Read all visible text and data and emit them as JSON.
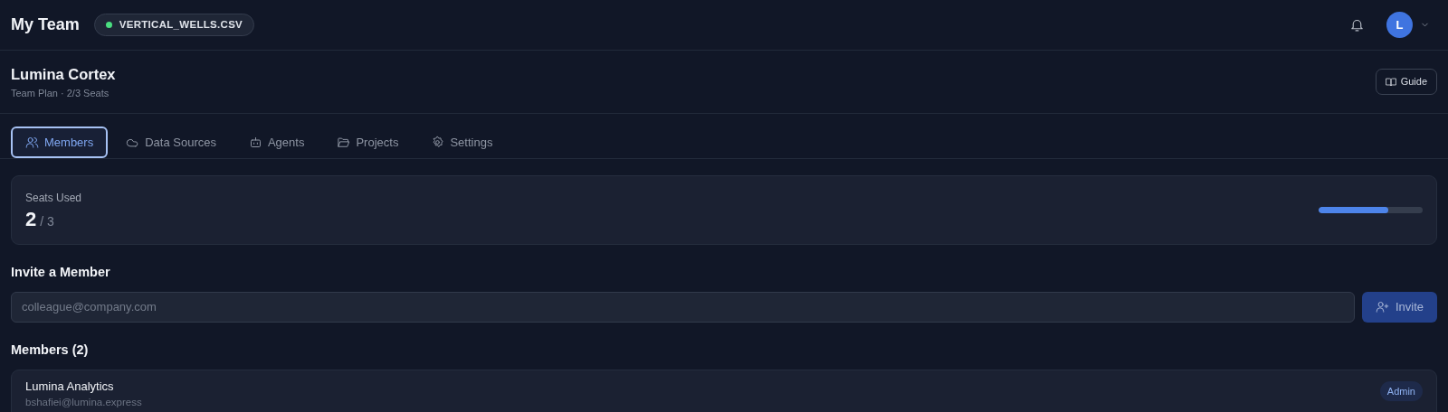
{
  "header": {
    "title": "My Team",
    "file_badge": {
      "label": "VERTICAL_WELLS.CSV",
      "color": "#4ade80"
    },
    "avatar": "L"
  },
  "org": {
    "name": "Lumina Cortex",
    "plan": "Team Plan · 2/3 Seats",
    "guide_button": "Guide"
  },
  "tabs": [
    {
      "label": "Members",
      "selected": true
    },
    {
      "label": "Data Sources",
      "selected": false
    },
    {
      "label": "Agents",
      "selected": false
    },
    {
      "label": "Projects",
      "selected": false
    },
    {
      "label": "Settings",
      "selected": false
    }
  ],
  "seats": {
    "label": "Seats Used",
    "used": "2",
    "total": "/ 3",
    "level": 0.67
  },
  "invite": {
    "heading": "Invite a Member",
    "placeholder": "colleague@company.com",
    "button": "Invite"
  },
  "members": {
    "heading": "Members (2)",
    "items": [
      {
        "name": "Lumina Analytics",
        "email": "bshafiei@lumina.express",
        "role": "Admin"
      }
    ]
  }
}
